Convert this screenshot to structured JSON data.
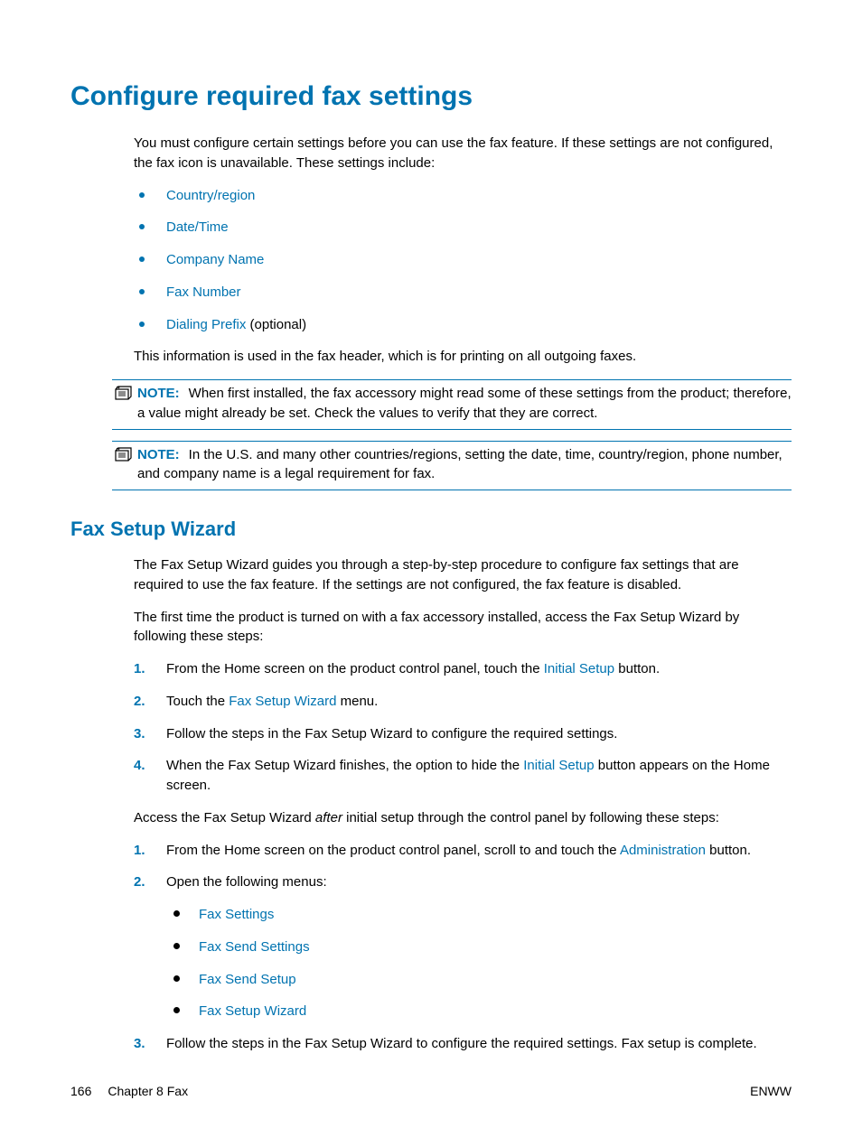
{
  "h1": "Configure required fax settings",
  "intro": "You must configure certain settings before you can use the fax feature. If these settings are not configured, the fax icon is unavailable. These settings include:",
  "settings_list": [
    {
      "link": "Country/region",
      "tail": ""
    },
    {
      "link": "Date/Time",
      "tail": ""
    },
    {
      "link": "Company Name",
      "tail": ""
    },
    {
      "link": "Fax Number",
      "tail": ""
    },
    {
      "link": "Dialing Prefix",
      "tail": " (optional)"
    }
  ],
  "header_info": "This information is used in the fax header, which is for printing on all outgoing faxes.",
  "note_label": "NOTE:",
  "notes": [
    "When first installed, the fax accessory might read some of these settings from the product; therefore, a value might already be set. Check the values to verify that they are correct.",
    "In the U.S. and many other countries/regions, setting the date, time, country/region, phone number, and company name is a legal requirement for fax."
  ],
  "h2": "Fax Setup Wizard",
  "wizard_intro": "The Fax Setup Wizard guides you through a step-by-step procedure to configure fax settings that are required to use the fax feature. If the settings are not configured, the fax feature is disabled.",
  "wizard_first_time": "The first time the product is turned on with a fax accessory installed, access the Fax Setup Wizard by following these steps:",
  "steps1": [
    {
      "pre": "From the Home screen on the product control panel, touch the ",
      "link": "Initial Setup",
      "post": " button."
    },
    {
      "pre": "Touch the ",
      "link": "Fax Setup Wizard",
      "post": " menu."
    },
    {
      "pre": "Follow the steps in the Fax Setup Wizard to configure the required settings.",
      "link": "",
      "post": ""
    },
    {
      "pre": "When the Fax Setup Wizard finishes, the option to hide the ",
      "link": "Initial Setup",
      "post": " button appears on the Home screen."
    }
  ],
  "after_initial_pre": "Access the Fax Setup Wizard ",
  "after_initial_italic": "after",
  "after_initial_post": " initial setup through the control panel by following these steps:",
  "steps2_item1": {
    "pre": "From the Home screen on the product control panel, scroll to and touch the ",
    "link": "Administration",
    "post": " button."
  },
  "steps2_item2_intro": "Open the following menus:",
  "steps2_menus": [
    "Fax Settings",
    "Fax Send Settings",
    "Fax Send Setup",
    "Fax Setup Wizard"
  ],
  "steps2_item3": "Follow the steps in the Fax Setup Wizard to configure the required settings. Fax setup is complete.",
  "footer": {
    "page": "166",
    "chapter": "Chapter 8   Fax",
    "right": "ENWW"
  }
}
